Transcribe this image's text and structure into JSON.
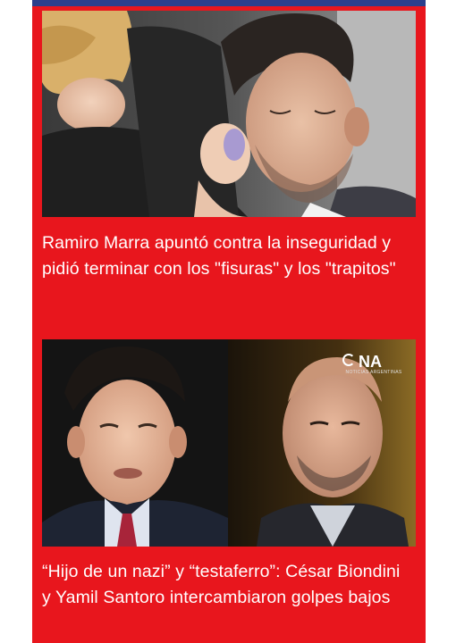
{
  "articles": [
    {
      "headline": "Ramiro Marra apuntó contra la inseguridad y pidió terminar con los \"fisuras\" y los \"trapitos\"",
      "image": "man-receiving-makeup-photo"
    },
    {
      "headline": "“Hijo de un nazi” y “testaferro”: César Biondini y Yamil Santoro intercambiaron golpes bajos",
      "image": "two-men-debate-split-photo",
      "watermark": {
        "brand": "NA",
        "subtitle": "NOTICIAS ARGENTINAS"
      }
    }
  ],
  "colors": {
    "feed_background": "#e8161d",
    "top_bar": "#2b3f8c",
    "text": "#ffffff"
  }
}
